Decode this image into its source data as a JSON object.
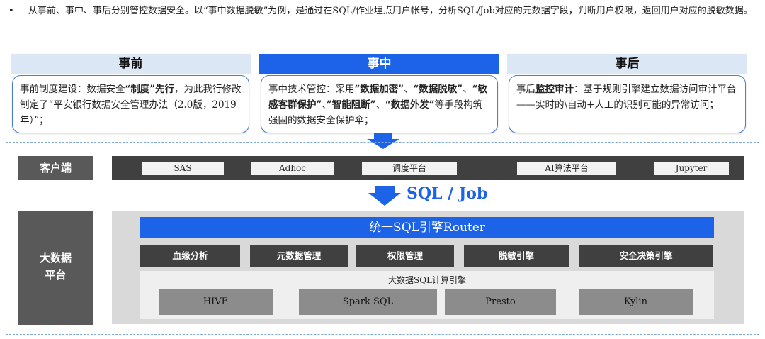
{
  "intro": {
    "bullet": "•",
    "text": "从事前、事中、事后分别管控数据安全。以“事中数据脱敏”为例，是通过在SQL/作业埋点用户帐号，分析SQL/Job对应的元数据字段，判断用户权限，返回用户对应的脱敏数据。"
  },
  "phases": [
    {
      "title": "事前",
      "body": [
        {
          "t": "事前制度建设：数据安全",
          "b": false
        },
        {
          "t": "“制度”先行",
          "b": true
        },
        {
          "t": "，为此我行修改制定了“平安银行数据安全管理办法（2.0版，2019年）”；",
          "b": false
        }
      ]
    },
    {
      "title": "事中",
      "body": [
        {
          "t": "事中技术管控：采用",
          "b": false
        },
        {
          "t": "“数据加密”",
          "b": true
        },
        {
          "t": "、",
          "b": false
        },
        {
          "t": "“数据脱敏”",
          "b": true
        },
        {
          "t": "、",
          "b": false
        },
        {
          "t": "“敏感客群保护”",
          "b": true
        },
        {
          "t": "、",
          "b": false
        },
        {
          "t": "”智能阻断”",
          "b": true
        },
        {
          "t": "、",
          "b": false
        },
        {
          "t": "“数据外发”",
          "b": true
        },
        {
          "t": "等手段构筑强固的数据安全保护伞；",
          "b": false
        }
      ]
    },
    {
      "title": "事后",
      "body": [
        {
          "t": "事后",
          "b": false
        },
        {
          "t": "监控审计",
          "b": true
        },
        {
          "t": "：基于规则引擎建立数据访问审计平台——实时的\\自动+人工的识别可能的异常访问；",
          "b": false
        }
      ]
    }
  ],
  "client": {
    "label": "客户端",
    "items": [
      "SAS",
      "Adhoc",
      "调度平台",
      "AI算法平台",
      "Jupyter"
    ]
  },
  "flow_label": "SQL / Job",
  "platform": {
    "label_line1": "大数据",
    "label_line2": "平台",
    "router": "统一SQL引擎Router",
    "modules": [
      "血缘分析",
      "元数据管理",
      "权限管理",
      "脱敏引擎",
      "安全决策引擎"
    ],
    "engine_title": "大数据SQL计算引擎",
    "engines": [
      "HIVE",
      "Spark SQL",
      "Presto",
      "Kylin"
    ]
  },
  "colors": {
    "accent": "#1c63e8",
    "dark": "#404040",
    "light_header": "#dbe7f5"
  }
}
